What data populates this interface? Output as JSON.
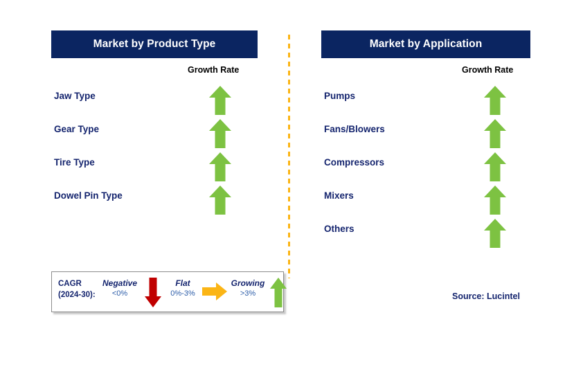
{
  "panels": [
    {
      "id": "product-type",
      "title": "Market by Product Type",
      "column_header": "Growth Rate",
      "rows": [
        {
          "label": "Jaw Type",
          "trend": "growing",
          "icon": "up-arrow-icon"
        },
        {
          "label": "Gear Type",
          "trend": "growing",
          "icon": "up-arrow-icon"
        },
        {
          "label": "Tire Type",
          "trend": "growing",
          "icon": "up-arrow-icon"
        },
        {
          "label": "Dowel Pin Type",
          "trend": "growing",
          "icon": "up-arrow-icon"
        }
      ]
    },
    {
      "id": "application",
      "title": "Market by Application",
      "column_header": "Growth Rate",
      "rows": [
        {
          "label": "Pumps",
          "trend": "growing",
          "icon": "up-arrow-icon"
        },
        {
          "label": "Fans/Blowers",
          "trend": "growing",
          "icon": "up-arrow-icon"
        },
        {
          "label": "Compressors",
          "trend": "growing",
          "icon": "up-arrow-icon"
        },
        {
          "label": "Mixers",
          "trend": "growing",
          "icon": "up-arrow-icon"
        },
        {
          "label": "Others",
          "trend": "growing",
          "icon": "up-arrow-icon"
        }
      ]
    }
  ],
  "legend": {
    "title_line1": "CAGR",
    "title_line2": "(2024-30):",
    "items": [
      {
        "word": "Negative",
        "value": "<0%",
        "icon": "down-arrow-icon",
        "color": "#C00000"
      },
      {
        "word": "Flat",
        "value": "0%-3%",
        "icon": "right-arrow-icon",
        "color": "#FBB515"
      },
      {
        "word": "Growing",
        "value": ">3%",
        "icon": "up-arrow-icon",
        "color": "#7DC242"
      }
    ]
  },
  "source": "Source: Lucintel",
  "colors": {
    "header_navy": "#0B2561",
    "label_navy": "#14246E",
    "arrow_green": "#7DC242",
    "arrow_red": "#C00000",
    "arrow_amber": "#FBB515",
    "divider_amber": "#FBB515",
    "legend_border": "#8C8C8C",
    "background": "#FFFFFF"
  },
  "chart_data": {
    "type": "table",
    "title": "Market Segmentation Growth Outlook",
    "categories": [
      "Jaw Type",
      "Gear Type",
      "Tire Type",
      "Dowel Pin Type",
      "Pumps",
      "Fans/Blowers",
      "Compressors",
      "Mixers",
      "Others"
    ],
    "series": [
      {
        "name": "Market by Product Type",
        "categories": [
          "Jaw Type",
          "Gear Type",
          "Tire Type",
          "Dowel Pin Type"
        ],
        "values": [
          "growing",
          "growing",
          "growing",
          "growing"
        ]
      },
      {
        "name": "Market by Application",
        "categories": [
          "Pumps",
          "Fans/Blowers",
          "Compressors",
          "Mixers",
          "Others"
        ],
        "values": [
          "growing",
          "growing",
          "growing",
          "growing",
          "growing"
        ]
      }
    ],
    "legend_position": "bottom-left",
    "value_scale": {
      "negative": "<0%",
      "flat": "0%-3%",
      "growing": ">3%"
    },
    "period": "2024-30",
    "metric": "CAGR",
    "ylabel": "Growth Rate",
    "xlabel": ""
  }
}
